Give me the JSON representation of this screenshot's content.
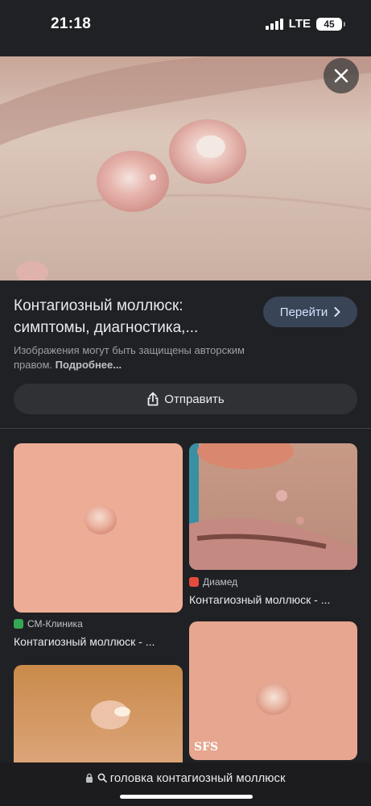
{
  "status": {
    "time": "21:18",
    "network": "LTE",
    "battery": "45"
  },
  "viewer": {
    "title": "Контагиозный моллюск: симптомы, диагностика,...",
    "go_label": "Перейти",
    "copyright_text": "Изображения могут быть защищены авторским правом.",
    "copyright_more": "Подробнее...",
    "share_label": "Отправить"
  },
  "related": [
    {
      "source": "СМ-Клиника",
      "caption": "Контагиозный моллюск - ...",
      "favicon_color": "#34a853"
    },
    {
      "source": "Диамед",
      "caption": "Контагиозный моллюск - ...",
      "favicon_color": "#e64a3c"
    },
    {
      "source": "",
      "caption": "",
      "watermark": ""
    },
    {
      "source": "",
      "caption": "",
      "watermark": "SFS"
    }
  ],
  "address_bar": {
    "query": "головка контагиозный моллюск"
  }
}
